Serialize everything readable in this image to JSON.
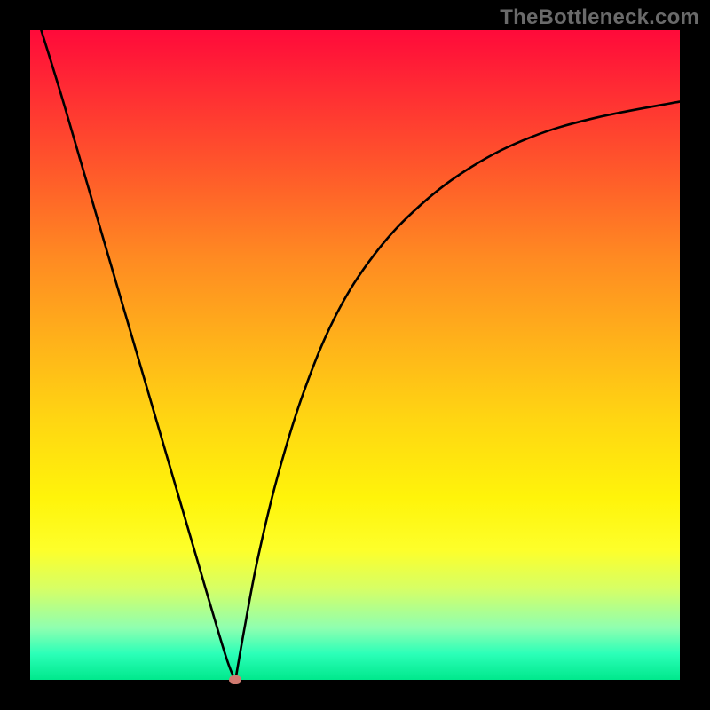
{
  "branding": "TheBottleneck.com",
  "chart_data": {
    "type": "line",
    "title": "",
    "xlabel": "",
    "ylabel": "",
    "xlim": [
      0,
      1
    ],
    "ylim": [
      0,
      1
    ],
    "series": [
      {
        "name": "left-branch",
        "x": [
          0.017,
          0.05,
          0.1,
          0.15,
          0.2,
          0.25,
          0.3,
          0.316
        ],
        "y": [
          1.0,
          0.893,
          0.722,
          0.551,
          0.38,
          0.209,
          0.04,
          0.0
        ]
      },
      {
        "name": "right-branch",
        "x": [
          0.316,
          0.33,
          0.35,
          0.38,
          0.42,
          0.47,
          0.53,
          0.6,
          0.68,
          0.77,
          0.87,
          1.0
        ],
        "y": [
          0.0,
          0.08,
          0.185,
          0.31,
          0.44,
          0.56,
          0.655,
          0.73,
          0.79,
          0.835,
          0.865,
          0.89
        ]
      }
    ],
    "minimum_point": {
      "x": 0.316,
      "y": 0.0
    },
    "annotations": []
  },
  "colors": {
    "curve": "#000000",
    "min_marker": "#d07a70",
    "frame": "#000000"
  }
}
